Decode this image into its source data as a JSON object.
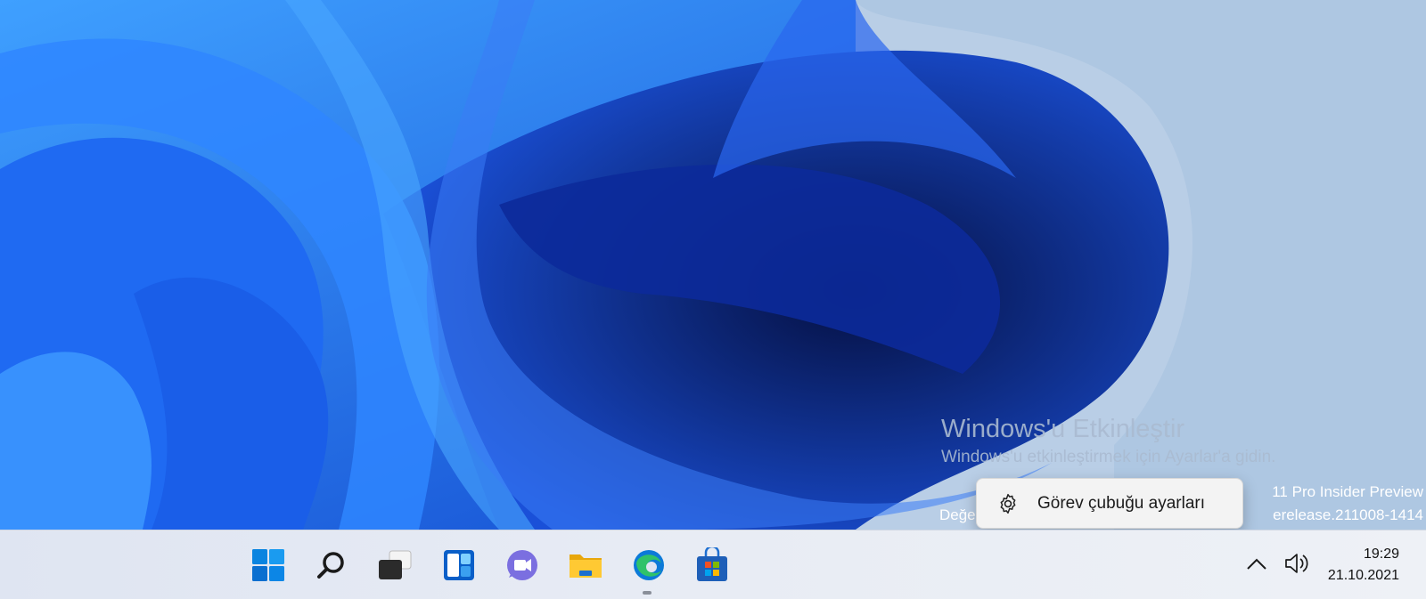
{
  "watermark": {
    "title": "Windows'u Etkinleştir",
    "subtitle": "Windows'u etkinleştirmek için Ayarlar'a gidin."
  },
  "build_info": {
    "line1_visible": "11 Pro Insider Preview",
    "line2_left_visible": "Değe",
    "line2_right_visible": "erelease.211008-1414"
  },
  "context_menu": {
    "icon": "gear-icon",
    "label": "Görev çubuğu ayarları"
  },
  "taskbar": {
    "icons": [
      "windows-start-icon",
      "search-icon",
      "task-view-icon",
      "widgets-icon",
      "teams-chat-icon",
      "file-explorer-icon",
      "edge-browser-icon",
      "microsoft-store-icon"
    ],
    "active": "edge-browser-icon"
  },
  "tray": {
    "chevron": "chevron-up-icon",
    "volume": "speaker-icon",
    "time": "19:29",
    "date": "21.10.2021"
  },
  "colors": {
    "accent": "#0067c0",
    "wallpaper_blue": "#1b5de0"
  }
}
